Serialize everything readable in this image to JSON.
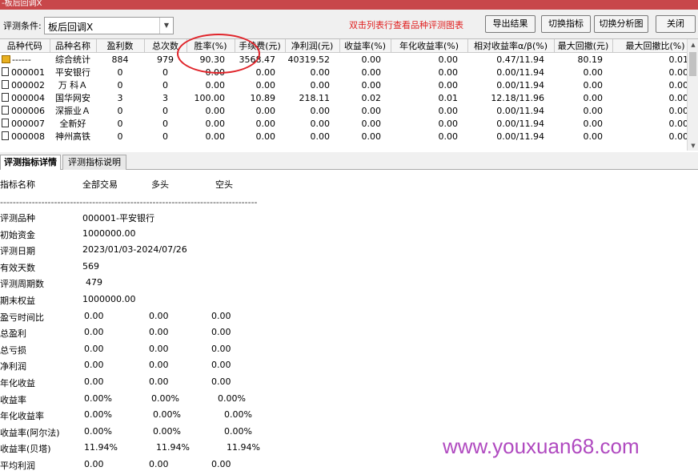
{
  "window": {
    "title": "-板后回调X"
  },
  "toolbar": {
    "condition_label": "评测条件:",
    "condition_value": "板后回调X",
    "hint": "双击列表行查看品种评测图表",
    "export_label": "导出结果",
    "switch_indicator_label": "切换指标",
    "switch_chart_label": "切换分析图",
    "close_label": "关闭"
  },
  "grid": {
    "headers": [
      "品种代码",
      "品种名称",
      "盈利数",
      "总次数",
      "胜率(%)",
      "手续费(元)",
      "净利润(元)",
      "收益率(%)",
      "年化收益率(%)",
      "相对收益率α/β(%)",
      "最大回撤(元)",
      "最大回撤比(%)"
    ],
    "rows": [
      {
        "code": "------",
        "name": "综合统计",
        "wins": "884",
        "total": "979",
        "winrate": "90.30",
        "fee": "3568.47",
        "profit": "40319.52",
        "ret": "0.00",
        "annual": "0.00",
        "relative": "0.47/11.94",
        "maxdd": "80.19",
        "maxddr": "0.01"
      },
      {
        "code": "000001",
        "name": "平安银行",
        "wins": "0",
        "total": "0",
        "winrate": "0.00",
        "fee": "0.00",
        "profit": "0.00",
        "ret": "0.00",
        "annual": "0.00",
        "relative": "0.00/11.94",
        "maxdd": "0.00",
        "maxddr": "0.00"
      },
      {
        "code": "000002",
        "name": "万 科Ａ",
        "wins": "0",
        "total": "0",
        "winrate": "0.00",
        "fee": "0.00",
        "profit": "0.00",
        "ret": "0.00",
        "annual": "0.00",
        "relative": "0.00/11.94",
        "maxdd": "0.00",
        "maxddr": "0.00"
      },
      {
        "code": "000004",
        "name": "国华网安",
        "wins": "3",
        "total": "3",
        "winrate": "100.00",
        "fee": "10.89",
        "profit": "218.11",
        "ret": "0.02",
        "annual": "0.01",
        "relative": "12.18/11.96",
        "maxdd": "0.00",
        "maxddr": "0.00"
      },
      {
        "code": "000006",
        "name": "深振业Ａ",
        "wins": "0",
        "total": "0",
        "winrate": "0.00",
        "fee": "0.00",
        "profit": "0.00",
        "ret": "0.00",
        "annual": "0.00",
        "relative": "0.00/11.94",
        "maxdd": "0.00",
        "maxddr": "0.00"
      },
      {
        "code": "000007",
        "name": "全新好",
        "wins": "0",
        "total": "0",
        "winrate": "0.00",
        "fee": "0.00",
        "profit": "0.00",
        "ret": "0.00",
        "annual": "0.00",
        "relative": "0.00/11.94",
        "maxdd": "0.00",
        "maxddr": "0.00"
      },
      {
        "code": "000008",
        "name": "神州高铁",
        "wins": "0",
        "total": "0",
        "winrate": "0.00",
        "fee": "0.00",
        "profit": "0.00",
        "ret": "0.00",
        "annual": "0.00",
        "relative": "0.00/11.94",
        "maxdd": "0.00",
        "maxddr": "0.00"
      }
    ]
  },
  "tabs": [
    {
      "label": "评测指标详情"
    },
    {
      "label": "评测指标说明"
    }
  ],
  "detail": {
    "header": [
      "指标名称",
      "全部交易",
      "多头",
      "空头"
    ],
    "separator": "---------------------------------------------------------------------------------",
    "rows": [
      {
        "label": "评测品种",
        "v": [
          "000001-平安银行"
        ]
      },
      {
        "label": "初始资金",
        "v": [
          "1000000.00"
        ]
      },
      {
        "label": "评测日期",
        "v": [
          "2023/01/03-2024/07/26"
        ]
      },
      {
        "label": "有效天数",
        "v": [
          "569"
        ]
      },
      {
        "label": "评测周期数",
        "v": [
          "479"
        ]
      },
      {
        "label": "期末权益",
        "v": [
          "1000000.00"
        ]
      },
      {
        "label": "盈亏时间比",
        "v": [
          "0.00",
          "0.00",
          "0.00"
        ]
      },
      {
        "label": "总盈利",
        "v": [
          "0.00",
          "0.00",
          "0.00"
        ]
      },
      {
        "label": "总亏损",
        "v": [
          "0.00",
          "0.00",
          "0.00"
        ]
      },
      {
        "label": "净利润",
        "v": [
          "0.00",
          "0.00",
          "0.00"
        ]
      },
      {
        "label": "年化收益",
        "v": [
          "0.00",
          "0.00",
          "0.00"
        ]
      },
      {
        "label": "收益率",
        "v": [
          "0.00%",
          "0.00%",
          "0.00%"
        ]
      },
      {
        "label": "年化收益率",
        "v": [
          "0.00%",
          "0.00%",
          "0.00%"
        ]
      },
      {
        "label": "收益率(阿尔法)",
        "v": [
          "0.00%",
          "0.00%",
          "0.00%"
        ]
      },
      {
        "label": "收益率(贝塔)",
        "v": [
          "11.94%",
          "11.94%",
          "11.94%"
        ]
      },
      {
        "label": "平均利润",
        "v": [
          "0.00",
          "0.00",
          "0.00"
        ]
      }
    ]
  },
  "watermark": "www.youxuan68.com"
}
